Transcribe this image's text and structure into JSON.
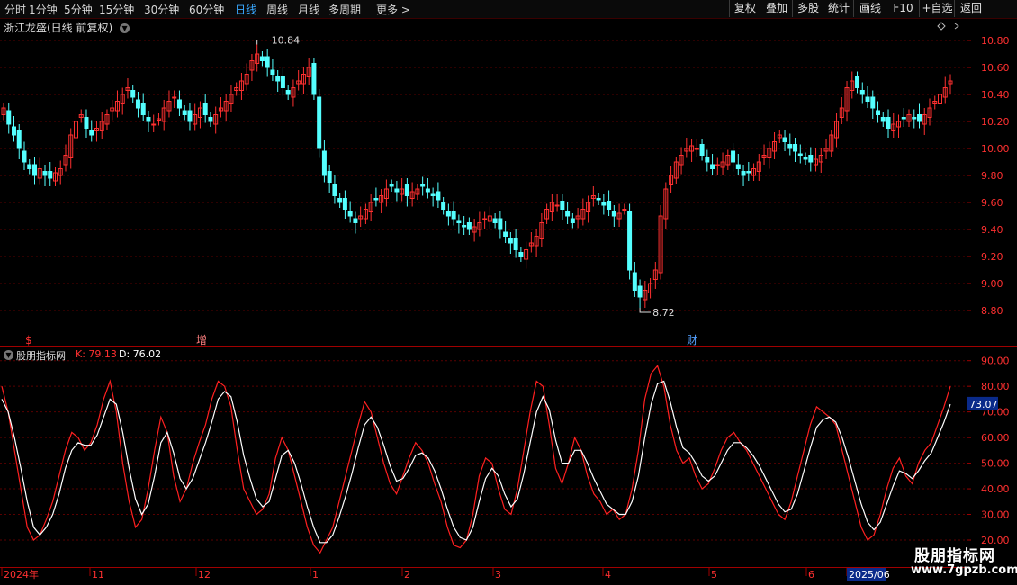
{
  "toolbar": {
    "periods": [
      "分时",
      "1分钟",
      "5分钟",
      "15分钟",
      "30分钟",
      "60分钟",
      "日线",
      "周线",
      "月线",
      "多周期",
      "更多 >"
    ],
    "active_period": "日线",
    "right_buttons": [
      "复权",
      "叠加",
      "多股",
      "统计",
      "画线",
      "F10",
      "+自选",
      "返回"
    ]
  },
  "stock": {
    "title": "浙江龙盛(日线 前复权)",
    "high_label": "10.84",
    "low_label": "8.72",
    "markers": [
      "$",
      "增",
      "财"
    ]
  },
  "indicator": {
    "name": "股朋指标网",
    "k_label": "K: 79.13",
    "d_label": "D: 76.02",
    "current_value": "73.07"
  },
  "chart_data": [
    {
      "type": "candlestick",
      "title": "浙江龙盛(日线 前复权)",
      "ylim": [
        8.6,
        10.9
      ],
      "yticks": [
        "10.80",
        "10.60",
        "10.40",
        "10.20",
        "10.00",
        "9.80",
        "9.60",
        "9.40",
        "9.20",
        "9.00",
        "8.80"
      ],
      "close": [
        10.3,
        10.18,
        10.1,
        10.0,
        9.9,
        9.85,
        9.8,
        9.85,
        9.8,
        9.78,
        9.82,
        9.85,
        9.95,
        10.1,
        10.2,
        10.25,
        10.15,
        10.1,
        10.15,
        10.2,
        10.25,
        10.3,
        10.35,
        10.4,
        10.45,
        10.38,
        10.3,
        10.25,
        10.2,
        10.18,
        10.22,
        10.3,
        10.35,
        10.38,
        10.3,
        10.25,
        10.2,
        10.25,
        10.3,
        10.25,
        10.2,
        10.25,
        10.3,
        10.35,
        10.4,
        10.45,
        10.5,
        10.55,
        10.65,
        10.7,
        10.65,
        10.6,
        10.55,
        10.5,
        10.45,
        10.4,
        10.45,
        10.5,
        10.55,
        10.6,
        10.4,
        10.0,
        9.8,
        9.75,
        9.65,
        9.6,
        9.55,
        9.5,
        9.45,
        9.5,
        9.55,
        9.6,
        9.62,
        9.65,
        9.7,
        9.72,
        9.68,
        9.7,
        9.65,
        9.68,
        9.7,
        9.72,
        9.68,
        9.65,
        9.62,
        9.55,
        9.5,
        9.48,
        9.45,
        9.42,
        9.4,
        9.42,
        9.45,
        9.48,
        9.5,
        9.45,
        9.4,
        9.35,
        9.3,
        9.25,
        9.2,
        9.25,
        9.3,
        9.35,
        9.45,
        9.55,
        9.6,
        9.58,
        9.55,
        9.5,
        9.45,
        9.5,
        9.55,
        9.6,
        9.65,
        9.62,
        9.58,
        9.55,
        9.5,
        9.52,
        9.55,
        9.1,
        8.95,
        8.9,
        8.95,
        9.0,
        9.1,
        9.5,
        9.7,
        9.8,
        9.9,
        9.95,
        10.0,
        10.02,
        10.0,
        9.95,
        9.9,
        9.85,
        9.88,
        9.9,
        9.95,
        9.9,
        9.85,
        9.8,
        9.82,
        9.85,
        9.9,
        9.95,
        10.0,
        10.05,
        10.1,
        10.05,
        10.0,
        9.98,
        9.95,
        9.92,
        9.9,
        9.92,
        9.95,
        10.0,
        10.1,
        10.2,
        10.3,
        10.45,
        10.5,
        10.45,
        10.4,
        10.35,
        10.3,
        10.25,
        10.2,
        10.15,
        10.18,
        10.2,
        10.22,
        10.25,
        10.22,
        10.2,
        10.25,
        10.3,
        10.35,
        10.4,
        10.45,
        10.5
      ]
    },
    {
      "type": "line",
      "title": "股朋指标网",
      "ylim": [
        20,
        92
      ],
      "yticks": [
        "90.00",
        "80.00",
        "70.00",
        "60.00",
        "50.00",
        "40.00",
        "30.00",
        "20.00"
      ],
      "x": [
        "2024年",
        "11",
        "12",
        "1",
        "2",
        "3",
        "4",
        "5",
        "6",
        "2025/06"
      ],
      "series": [
        {
          "name": "K",
          "color": "#ff2020",
          "values": [
            80,
            70,
            55,
            40,
            25,
            20,
            22,
            28,
            35,
            45,
            55,
            62,
            60,
            55,
            58,
            65,
            75,
            82,
            70,
            50,
            35,
            25,
            28,
            40,
            55,
            68,
            62,
            45,
            35,
            40,
            50,
            58,
            65,
            75,
            82,
            80,
            72,
            55,
            40,
            35,
            30,
            32,
            38,
            52,
            60,
            55,
            45,
            35,
            25,
            18,
            15,
            20,
            25,
            35,
            45,
            55,
            65,
            74,
            70,
            60,
            50,
            42,
            38,
            45,
            52,
            58,
            55,
            50,
            42,
            35,
            25,
            18,
            17,
            20,
            30,
            45,
            52,
            50,
            40,
            32,
            30,
            40,
            55,
            70,
            82,
            80,
            65,
            48,
            42,
            50,
            60,
            55,
            45,
            38,
            35,
            30,
            32,
            28,
            30,
            40,
            55,
            75,
            85,
            88,
            80,
            65,
            55,
            50,
            52,
            45,
            40,
            42,
            48,
            55,
            60,
            62,
            58,
            55,
            50,
            45,
            40,
            35,
            30,
            28,
            35,
            45,
            55,
            65,
            72,
            70,
            68,
            65,
            55,
            45,
            35,
            25,
            20,
            22,
            30,
            40,
            48,
            52,
            45,
            42,
            50,
            55,
            58,
            65,
            72,
            80
          ]
        },
        {
          "name": "D",
          "color": "#ffffff",
          "values": [
            75,
            70,
            60,
            48,
            35,
            25,
            22,
            25,
            30,
            38,
            48,
            55,
            58,
            57,
            57,
            61,
            68,
            75,
            73,
            62,
            48,
            36,
            30,
            34,
            45,
            58,
            62,
            54,
            44,
            40,
            44,
            51,
            58,
            66,
            75,
            78,
            76,
            66,
            53,
            44,
            36,
            33,
            35,
            44,
            53,
            55,
            50,
            42,
            33,
            25,
            19,
            19,
            22,
            29,
            37,
            46,
            56,
            65,
            68,
            64,
            57,
            49,
            43,
            44,
            48,
            53,
            54,
            52,
            47,
            40,
            32,
            25,
            21,
            20,
            25,
            35,
            44,
            48,
            45,
            38,
            33,
            36,
            46,
            58,
            70,
            76,
            71,
            59,
            50,
            50,
            55,
            55,
            50,
            44,
            39,
            34,
            32,
            30,
            30,
            35,
            45,
            60,
            73,
            81,
            82,
            74,
            64,
            56,
            54,
            50,
            45,
            43,
            45,
            50,
            55,
            58,
            58,
            56,
            53,
            49,
            44,
            39,
            34,
            31,
            32,
            38,
            47,
            56,
            64,
            67,
            68,
            66,
            60,
            52,
            43,
            34,
            27,
            24,
            27,
            34,
            41,
            47,
            46,
            44,
            47,
            51,
            54,
            60,
            66,
            73
          ]
        }
      ]
    }
  ]
}
